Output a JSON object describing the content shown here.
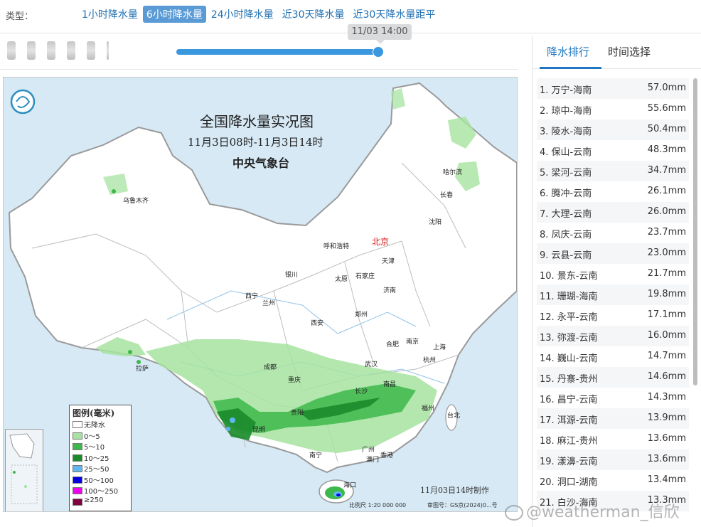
{
  "type_label": "类型：",
  "tabs": [
    {
      "label": "1小时降水量",
      "active": false
    },
    {
      "label": "6小时降水量",
      "active": true
    },
    {
      "label": "24小时降水量",
      "active": false
    },
    {
      "label": "近30天降水量",
      "active": false
    },
    {
      "label": "近30天降水量距平",
      "active": false
    }
  ],
  "timeline": {
    "current": "11/03 14:00",
    "progress": 0.98
  },
  "map": {
    "title": "全国降水量实况图",
    "period": "11月3日08时-11月3日14时",
    "agency": "中央气象台",
    "made_time": "11月03日14时制作",
    "scale": "比例尺 1:20 000 000",
    "approval": "审图号：GS京(2024)0...号",
    "capital": "北京",
    "cities": [
      "乌鲁木齐",
      "哈尔滨",
      "长春",
      "沈阳",
      "呼和浩特",
      "天津",
      "银川",
      "太原",
      "石家庄",
      "济南",
      "西宁",
      "兰州",
      "郑州",
      "西安",
      "合肥",
      "南京",
      "上海",
      "拉萨",
      "成都",
      "武汉",
      "杭州",
      "重庆",
      "长沙",
      "南昌",
      "贵阳",
      "福州",
      "台北",
      "昆明",
      "南宁",
      "广州",
      "香港",
      "澳门",
      "海口"
    ],
    "legend": {
      "title": "图例(毫米)",
      "items": [
        {
          "label": "无降水",
          "color": "#ffffff"
        },
        {
          "label": "0～5",
          "color": "#a6e3a0"
        },
        {
          "label": "5～10",
          "color": "#3db84a"
        },
        {
          "label": "10～25",
          "color": "#1a8a2a"
        },
        {
          "label": "25～50",
          "color": "#5fb6f0"
        },
        {
          "label": "50～100",
          "color": "#0000e0"
        },
        {
          "label": "100～250",
          "color": "#f000f0"
        },
        {
          "label": "≥250",
          "color": "#800040"
        }
      ]
    }
  },
  "panel": {
    "tabs": [
      "降水排行",
      "时间选择"
    ],
    "ranking": [
      {
        "name": "1. 万宁-海南",
        "value": "57.0mm"
      },
      {
        "name": "2. 琼中-海南",
        "value": "55.6mm"
      },
      {
        "name": "3. 陵水-海南",
        "value": "50.4mm"
      },
      {
        "name": "4. 保山-云南",
        "value": "48.3mm"
      },
      {
        "name": "5. 梁河-云南",
        "value": "34.7mm"
      },
      {
        "name": "6. 腾冲-云南",
        "value": "26.1mm"
      },
      {
        "name": "7. 大理-云南",
        "value": "26.0mm"
      },
      {
        "name": "8. 凤庆-云南",
        "value": "23.7mm"
      },
      {
        "name": "9. 云县-云南",
        "value": "23.0mm"
      },
      {
        "name": "10. 景东-云南",
        "value": "21.7mm"
      },
      {
        "name": "11. 珊瑚-海南",
        "value": "19.8mm"
      },
      {
        "name": "12. 永平-云南",
        "value": "17.1mm"
      },
      {
        "name": "13. 弥渡-云南",
        "value": "16.0mm"
      },
      {
        "name": "14. 巍山-云南",
        "value": "14.7mm"
      },
      {
        "name": "15. 丹寨-贵州",
        "value": "14.6mm"
      },
      {
        "name": "16. 昌宁-云南",
        "value": "14.3mm"
      },
      {
        "name": "17. 洱源-云南",
        "value": "13.9mm"
      },
      {
        "name": "18. 麻江-贵州",
        "value": "13.6mm"
      },
      {
        "name": "19. 漾濞-云南",
        "value": "13.6mm"
      },
      {
        "name": "20. 洞口-湖南",
        "value": "13.4mm"
      },
      {
        "name": "21. 白沙-海南",
        "value": "13.3mm"
      }
    ]
  },
  "watermark": "@weatherman_信欣"
}
